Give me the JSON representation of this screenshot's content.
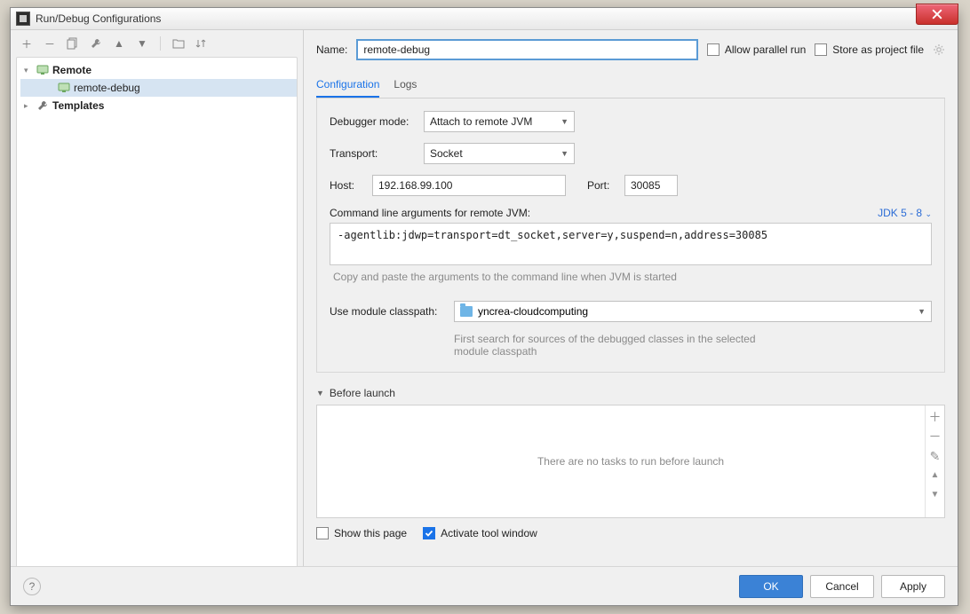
{
  "window": {
    "title": "Run/Debug Configurations"
  },
  "toolbar_icons": [
    "add",
    "remove",
    "copy",
    "wrench",
    "up",
    "down",
    "folder-move",
    "sort"
  ],
  "tree": {
    "nodes": [
      {
        "label": "Remote",
        "expanded": true,
        "icon": "remote-group",
        "bold": true
      },
      {
        "label": "remote-debug",
        "icon": "remote-config",
        "selected": true,
        "indent": 2
      },
      {
        "label": "Templates",
        "expanded": false,
        "icon": "wrench",
        "bold": true
      }
    ]
  },
  "header": {
    "name_label": "Name:",
    "name_value": "remote-debug",
    "allow_parallel": "Allow parallel run",
    "store_as_file": "Store as project file"
  },
  "tabs": [
    {
      "id": "configuration",
      "label": "Configuration",
      "active": true
    },
    {
      "id": "logs",
      "label": "Logs",
      "active": false
    }
  ],
  "config": {
    "debugger_mode_label": "Debugger mode:",
    "debugger_mode_value": "Attach to remote JVM",
    "transport_label": "Transport:",
    "transport_value": "Socket",
    "host_label": "Host:",
    "host_value": "192.168.99.100",
    "port_label": "Port:",
    "port_value": "30085",
    "cmd_label": "Command line arguments for remote JVM:",
    "jdk_label": "JDK 5 - 8",
    "cmd_value": "-agentlib:jdwp=transport=dt_socket,server=y,suspend=n,address=30085",
    "cmd_hint": "Copy and paste the arguments to the command line when JVM is started",
    "module_label": "Use module classpath:",
    "module_value": "yncrea-cloudcomputing",
    "module_hint": "First search for sources of the debugged classes in the selected module classpath"
  },
  "before_launch": {
    "title": "Before launch",
    "empty_text": "There are no tasks to run before launch",
    "side_buttons": [
      "add",
      "remove",
      "edit",
      "up",
      "down"
    ]
  },
  "bottom_opts": {
    "show_this_page": "Show this page",
    "activate_tool_window": "Activate tool window"
  },
  "footer": {
    "ok": "OK",
    "cancel": "Cancel",
    "apply": "Apply"
  }
}
